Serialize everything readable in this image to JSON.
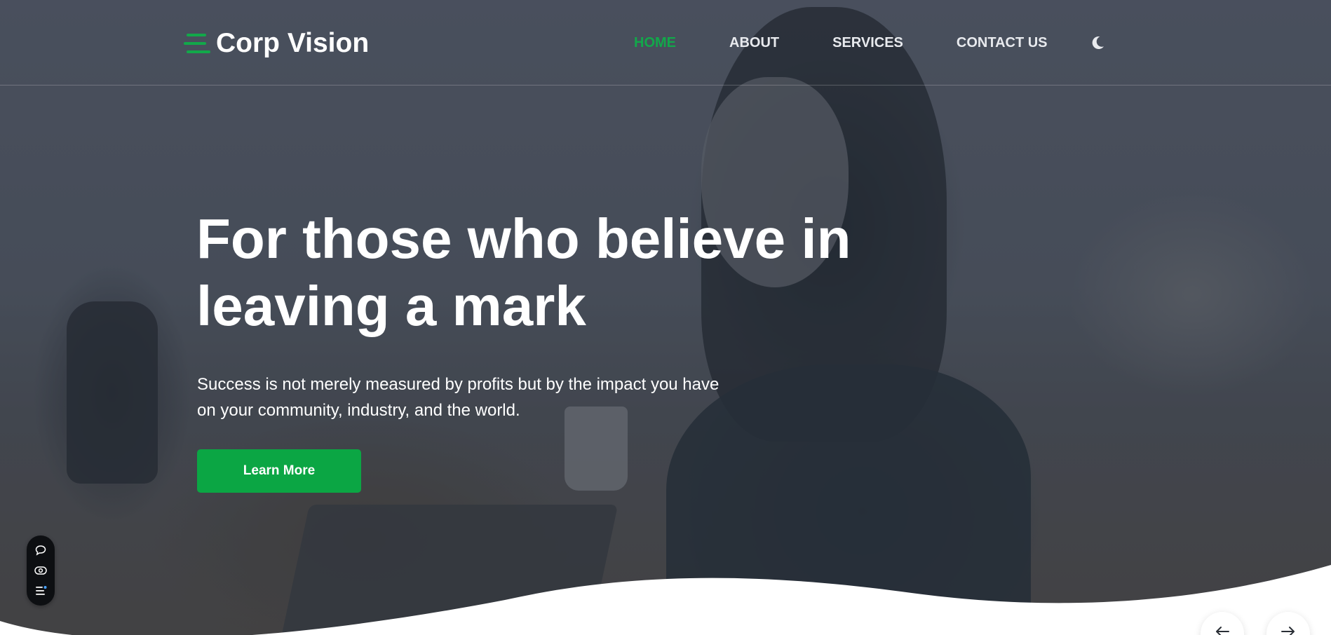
{
  "brand": {
    "name": "Corp Vision",
    "logo_icon": "menu-lines-icon",
    "accent_color": "#0BA644"
  },
  "nav": {
    "items": [
      {
        "label": "HOME",
        "active": true
      },
      {
        "label": "ABOUT",
        "active": false
      },
      {
        "label": "SERVICES",
        "active": false
      },
      {
        "label": "CONTACT US",
        "active": false
      }
    ],
    "theme_toggle_icon": "moon-icon"
  },
  "hero": {
    "headline": "For those who believe in leaving a mark",
    "subtext": "Success is not merely measured by profits but by the impact you have on your community, industry, and the world.",
    "cta_label": "Learn More"
  },
  "toolbar": {
    "icons": [
      "chat-bubble-icon",
      "eye-icon",
      "list-settings-icon"
    ]
  },
  "slider": {
    "prev_icon": "arrow-left-icon",
    "next_icon": "arrow-right-icon"
  }
}
